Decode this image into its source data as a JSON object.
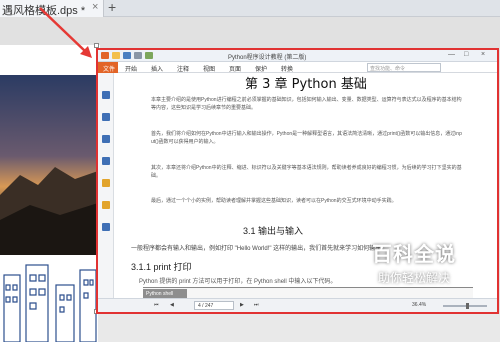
{
  "tab": {
    "title": "遇风格模板.dps *",
    "close": "×",
    "add": "+"
  },
  "pdf": {
    "title": "Python程序设计教程 (第二版)",
    "win_buttons": [
      "—",
      "□",
      "×"
    ],
    "menu": {
      "file": "文件",
      "items": [
        "开始",
        "插入",
        "注释",
        "视图",
        "页面",
        "保护",
        "转换"
      ]
    },
    "search_placeholder": "查找功能、命令",
    "chapter_title": "第 3 章  Python 基础",
    "paragraphs": [
      "本章主要介绍的是使用Python进行编程之前必须掌握的基础知识，包括如何输入输出、变量、数据类型、运算符与表达式以及程序的基本结构等内容，这些知识是学习后续章节的重要基础。",
      "首先，我们将介绍如何在Python中进行输入和输出操作，Python是一种解释型语言，其语法简洁清晰，通过print()函数可以输出信息，通过input()函数可以获得用户的输入。",
      "其次，本章还将介绍Python中的注释、缩进、标识符以及关键字等基本语法规则，帮助读者养成良好的编程习惯，为后续的学习打下坚实的基础。",
      "最后，通过一个个小的实例，帮助读者理解并掌握这些基础知识，读者可以在Python的交互式环境中动手实践。"
    ],
    "section": "3.1   输出与输入",
    "section_intro": "一般程序都会有输入和输出，例如打印 \"Hello World!\" 这样的输出，我们首先就来学习如何输出。",
    "subsection": "3.1.1   print 打印",
    "body_text": "Python 提供的 print 方法可以用于打印，在 Python shell 中输入以下代码。",
    "shell_label": "Python shell",
    "status": {
      "page": "4 / 247",
      "zoom": "36.4%",
      "zoom_fraction": 0.55
    }
  },
  "watermark": {
    "title": "百科全说",
    "subtitle": "助你轻松解决"
  },
  "colors": {
    "menu_accent": "#e26427",
    "highlight": "#e13232"
  }
}
